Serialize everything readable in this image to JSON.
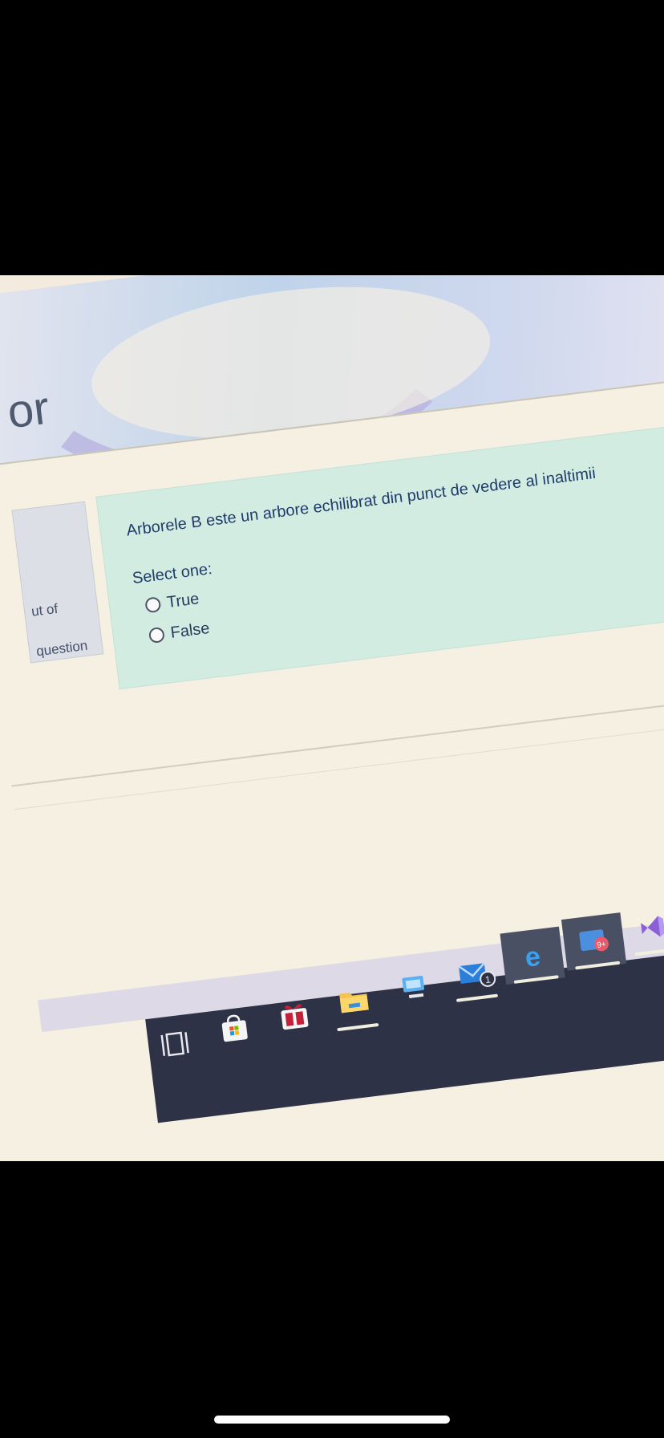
{
  "page": {
    "title_fragment": "or"
  },
  "sidebar_info": {
    "line1": "ut of",
    "line2": "question"
  },
  "question": {
    "text": "Arborele B este un arbore echilibrat din punct de vedere al inaltimii",
    "prompt": "Select one:",
    "options": [
      {
        "label": "True",
        "selected": false
      },
      {
        "label": "False",
        "selected": false
      }
    ]
  },
  "taskbar": {
    "icons": [
      {
        "name": "task-view-icon"
      },
      {
        "name": "microsoft-store-icon"
      },
      {
        "name": "gift-icon"
      },
      {
        "name": "file-explorer-icon"
      },
      {
        "name": "remote-desktop-icon"
      },
      {
        "name": "mail-icon",
        "badge": "1"
      },
      {
        "name": "edge-icon"
      },
      {
        "name": "photos-icon",
        "badge": "9+"
      },
      {
        "name": "visual-studio-icon"
      },
      {
        "name": "chrome-icon"
      }
    ]
  },
  "colors": {
    "question_bg": "#d3ece2",
    "page_bg": "#f6f0e2",
    "text": "#1f3c6a",
    "taskbar": "#2e3246"
  }
}
